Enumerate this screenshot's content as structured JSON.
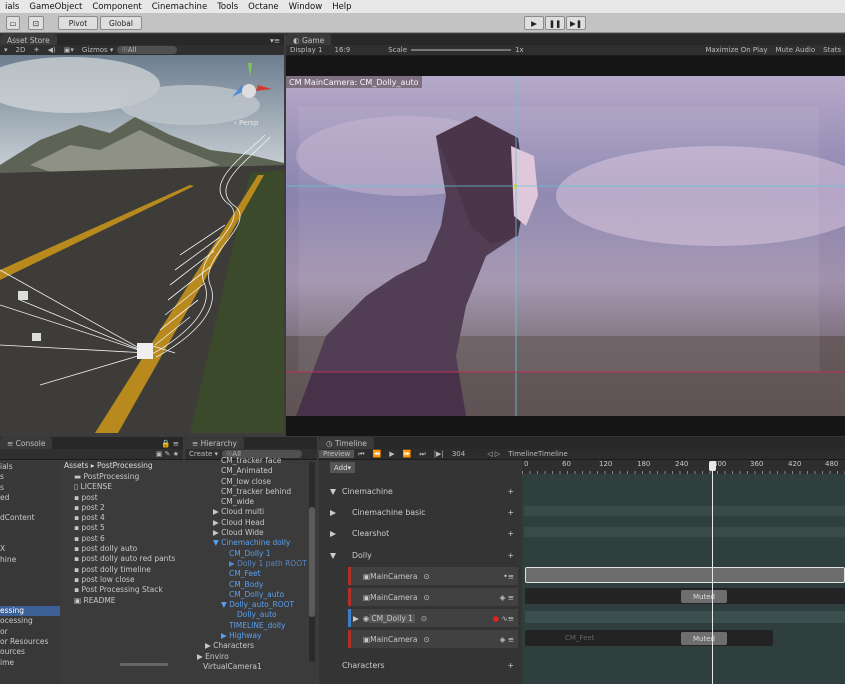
{
  "menu": [
    "ials",
    "GameObject",
    "Component",
    "Cinemachine",
    "Tools",
    "Octane",
    "Window",
    "Help"
  ],
  "toolbar": {
    "pivot": "Pivot",
    "global": "Global",
    "play": "▶",
    "pause": "❚❚",
    "step": "▶❚"
  },
  "scene_panel": {
    "tab": "Asset Store",
    "mode_2d": "2D",
    "gizmos": "Gizmos ▾",
    "search": "☉All",
    "persp": "‹ Persp"
  },
  "game_panel": {
    "tab": "Game",
    "display": "Display 1",
    "aspect": "16:9",
    "scale_label": "Scale",
    "scale_value": "1x",
    "maximize": "Maximize On Play",
    "mute": "Mute Audio",
    "stats": "Stats",
    "camera_label": "CM MainCamera: CM_Dolly_auto"
  },
  "console": {
    "tab": "Console",
    "left_items": [
      "ials",
      "s",
      "s",
      "ed",
      "",
      "dContent",
      "",
      "",
      "X",
      "hine",
      "",
      "",
      "",
      "",
      "essing",
      "ocessing",
      "or",
      "or Resources",
      "ources",
      "ime"
    ],
    "breadcrumb": "Assets ▸ PostProcessing",
    "assets": [
      "PostProcessing",
      "LICENSE",
      "post",
      "post 2",
      "post 4",
      "post 5",
      "post 6",
      "post dolly auto",
      "post dolly auto red pants",
      "post dolly timeline",
      "post low close",
      "Post Processing Stack",
      "README"
    ]
  },
  "hierarchy": {
    "tab": "Hierarchy",
    "create": "Create ▾",
    "search": "☉All",
    "items": [
      "CM_tracker face",
      "CM_Animated",
      "CM_low close",
      "CM_tracker behind",
      "CM_wide",
      "▶ Cloud multi",
      "▶ Cloud Head",
      "▶ Cloud Wide",
      "▼ Cinemachine dolly",
      "CM_Dolly 1",
      "▶ Dolly 1 path ROOT",
      "CM_Feet",
      "CM_Body",
      "CM_Dolly_auto",
      "▼ Dolly_auto_ROOT",
      "Dolly_auto",
      "TIMELINE_dolly",
      "▶ Highway",
      "▶ Characters",
      "▶ Enviro",
      "VirtualCamera1"
    ]
  },
  "timeline": {
    "tab": "Timeline",
    "preview": "Preview",
    "frame": "304",
    "add": "Add▾",
    "name": "TimelineTimeline",
    "ticks": [
      "0",
      "60",
      "120",
      "180",
      "240",
      "300",
      "360",
      "420",
      "480"
    ],
    "groups": [
      "Cinemachine",
      "Cinemachine basic",
      "Clearshot",
      "Dolly",
      "Characters"
    ],
    "tracks": [
      "MainCamera",
      "MainCamera",
      "CM_Dolly 1",
      "MainCamera"
    ],
    "muted": "Muted",
    "clip_feet": "CM_Feet"
  }
}
